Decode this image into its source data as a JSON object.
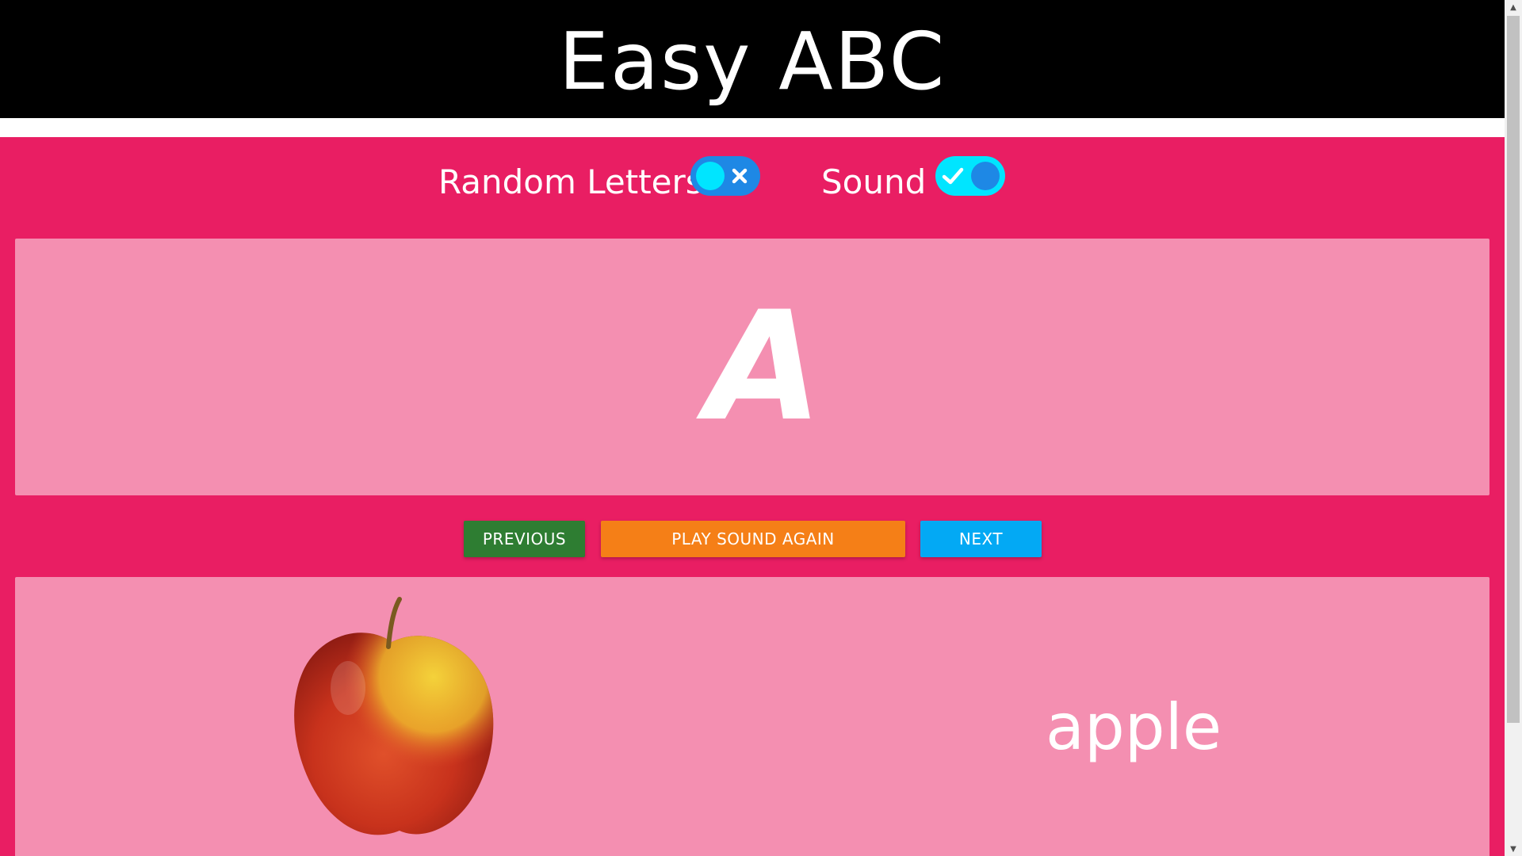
{
  "header": {
    "title": "Easy ABC"
  },
  "controls": {
    "random_letters": {
      "label": "Random Letters",
      "enabled": false
    },
    "sound": {
      "label": "Sound",
      "enabled": true
    }
  },
  "letter": {
    "value": "A"
  },
  "buttons": {
    "previous": "PREVIOUS",
    "play_sound_again": "PLAY SOUND AGAIN",
    "next": "NEXT"
  },
  "word": {
    "text": "apple",
    "image_icon": "apple-image"
  },
  "colors": {
    "header_bg": "#000000",
    "page_bg": "#e91e63",
    "panel_bg": "#f48fb1",
    "previous_btn": "#2e7d32",
    "play_btn": "#f57f17",
    "next_btn": "#03a9f4",
    "toggle_blue": "#1e88e5",
    "toggle_cyan": "#00e5ff"
  }
}
